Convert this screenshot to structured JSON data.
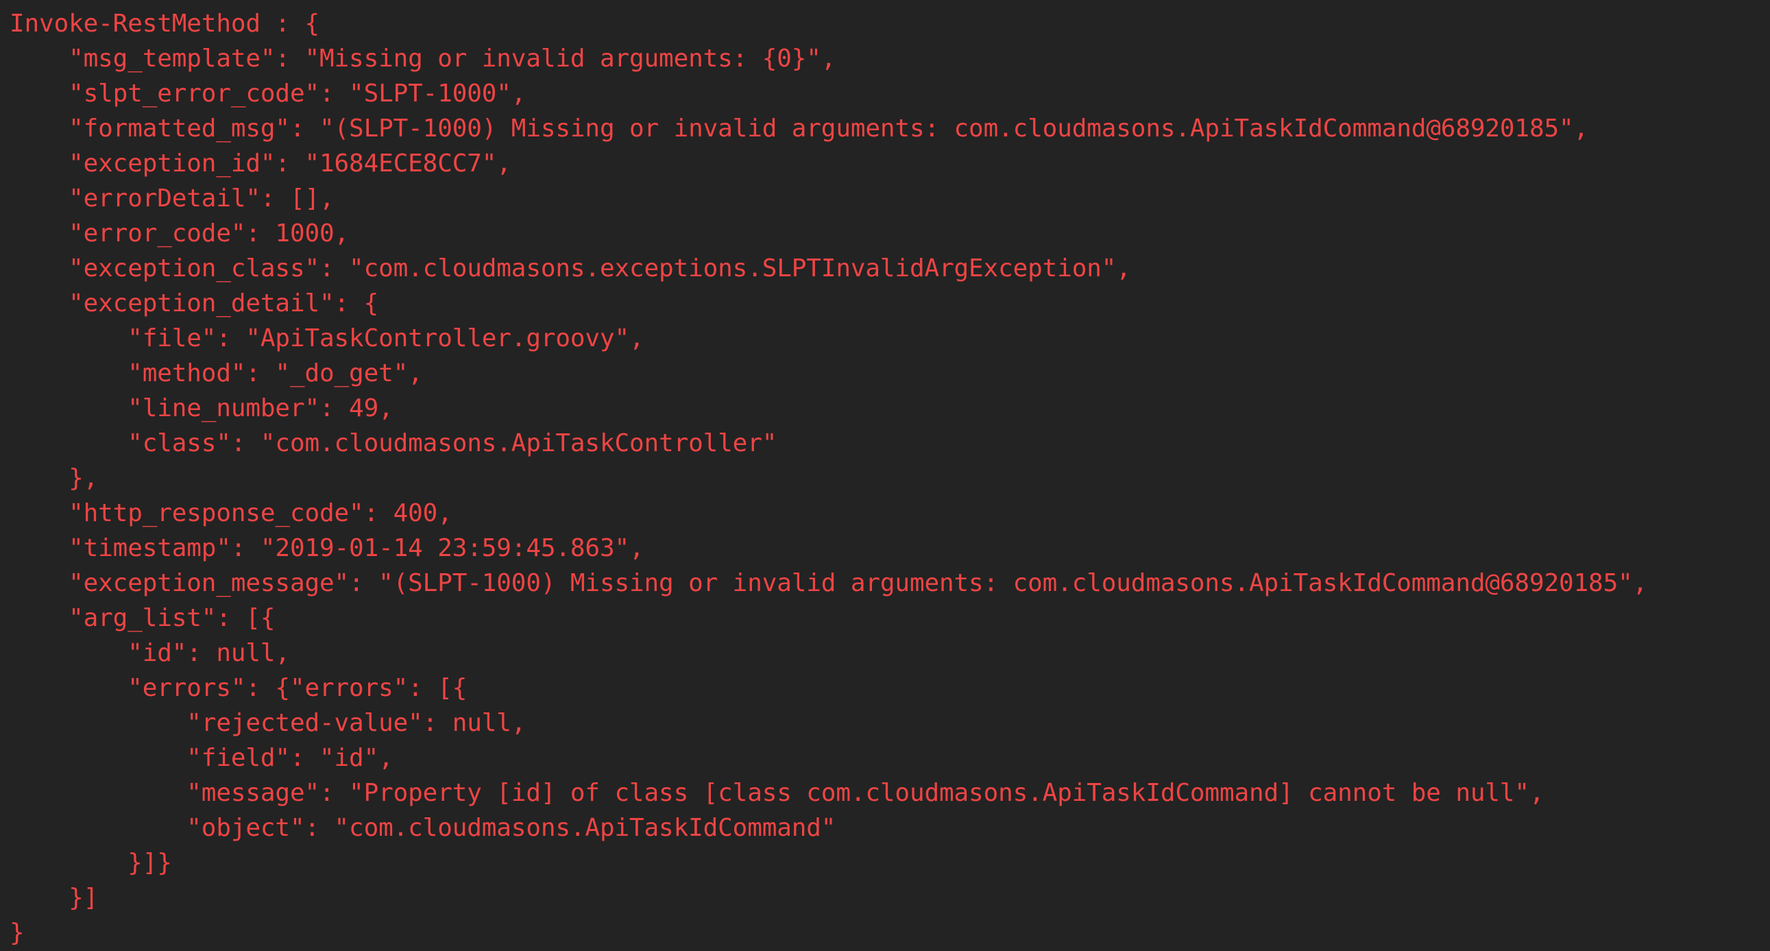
{
  "console": {
    "background_color": "#232323",
    "error_text_color": "#ee4444",
    "cmdlet_name": "Invoke-RestMethod",
    "lines": [
      "Invoke-RestMethod : {",
      "    \"msg_template\": \"Missing or invalid arguments: {0}\",",
      "    \"slpt_error_code\": \"SLPT-1000\",",
      "    \"formatted_msg\": \"(SLPT-1000) Missing or invalid arguments: com.cloudmasons.ApiTaskIdCommand@68920185\",",
      "    \"exception_id\": \"1684ECE8CC7\",",
      "    \"errorDetail\": [],",
      "    \"error_code\": 1000,",
      "    \"exception_class\": \"com.cloudmasons.exceptions.SLPTInvalidArgException\",",
      "    \"exception_detail\": {",
      "        \"file\": \"ApiTaskController.groovy\",",
      "        \"method\": \"_do_get\",",
      "        \"line_number\": 49,",
      "        \"class\": \"com.cloudmasons.ApiTaskController\"",
      "    },",
      "    \"http_response_code\": 400,",
      "    \"timestamp\": \"2019-01-14 23:59:45.863\",",
      "    \"exception_message\": \"(SLPT-1000) Missing or invalid arguments: com.cloudmasons.ApiTaskIdCommand@68920185\",",
      "    \"arg_list\": [{",
      "        \"id\": null,",
      "        \"errors\": {\"errors\": [{",
      "            \"rejected-value\": null,",
      "            \"field\": \"id\",",
      "            \"message\": \"Property [id] of class [class com.cloudmasons.ApiTaskIdCommand] cannot be null\",",
      "            \"object\": \"com.cloudmasons.ApiTaskIdCommand\"",
      "        }]}",
      "    }]",
      "}"
    ],
    "payload": {
      "msg_template": "Missing or invalid arguments: {0}",
      "slpt_error_code": "SLPT-1000",
      "formatted_msg": "(SLPT-1000) Missing or invalid arguments: com.cloudmasons.ApiTaskIdCommand@68920185",
      "exception_id": "1684ECE8CC7",
      "errorDetail": "[]",
      "error_code": "1000",
      "exception_class": "com.cloudmasons.exceptions.SLPTInvalidArgException",
      "exception_detail": {
        "file": "ApiTaskController.groovy",
        "method": "_do_get",
        "line_number": "49",
        "class": "com.cloudmasons.ApiTaskController"
      },
      "http_response_code": "400",
      "timestamp": "2019-01-14 23:59:45.863",
      "exception_message": "(SLPT-1000) Missing or invalid arguments: com.cloudmasons.ApiTaskIdCommand@68920185",
      "arg_list": [
        {
          "id": "null",
          "errors": {
            "errors": [
              {
                "rejected-value": "null",
                "field": "id",
                "message": "Property [id] of class [class com.cloudmasons.ApiTaskIdCommand] cannot be null",
                "object": "com.cloudmasons.ApiTaskIdCommand"
              }
            ]
          }
        }
      ]
    }
  }
}
